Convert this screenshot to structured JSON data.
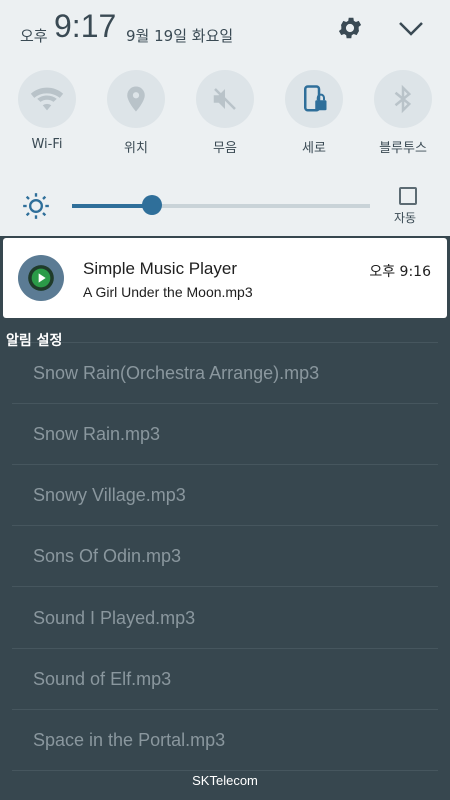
{
  "status": {
    "ampm": "오후",
    "time": "9:17",
    "date": "9월 19일 화요일"
  },
  "quick_settings": [
    {
      "label": "Wi-Fi",
      "icon": "wifi-icon"
    },
    {
      "label": "위치",
      "icon": "location-icon"
    },
    {
      "label": "무음",
      "icon": "mute-icon"
    },
    {
      "label": "세로",
      "icon": "portrait-lock-icon"
    },
    {
      "label": "블루투스",
      "icon": "bluetooth-icon"
    }
  ],
  "brightness": {
    "level": 0.27,
    "auto_label": "자동",
    "auto_checked": false
  },
  "notification": {
    "title": "Simple Music Player",
    "subtitle": "A Girl Under the Moon.mp3",
    "time": "오후 9:16"
  },
  "notification_settings_label": "알림 설정",
  "background_list": [
    "Snow Rain(Orchestra Arrange).mp3",
    "Snow Rain.mp3",
    "Snowy Village.mp3",
    "Sons Of Odin.mp3",
    "Sound I Played.mp3",
    "Sound of Elf.mp3",
    "Space in the Portal.mp3"
  ],
  "carrier": "SKTelecom",
  "colors": {
    "accent": "#2f6f9a",
    "shade_bg": "#ecf0f2",
    "list_bg": "#37474f"
  }
}
